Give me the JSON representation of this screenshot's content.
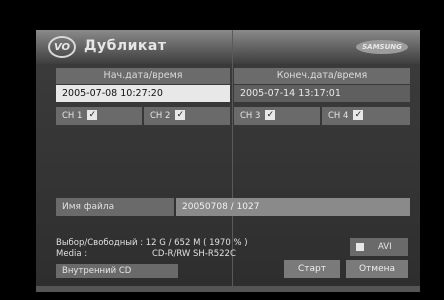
{
  "title": "Дубликат",
  "logo_text": "VO",
  "brand": "SAMSUNG",
  "start_header": "Нач.дата/время",
  "end_header": "Конеч.дата/время",
  "start_value": "2005-07-08   10:27:20",
  "end_value": "2005-07-14   13:17:01",
  "channels": [
    {
      "label": "CH 1",
      "checked": true
    },
    {
      "label": "CH 2",
      "checked": true
    },
    {
      "label": "CH 3",
      "checked": true
    },
    {
      "label": "CH 4",
      "checked": true
    }
  ],
  "file_label": "Имя файла",
  "file_value": "20050708 / 1027",
  "info_line1": "Выбор/Свободный : 12 G / 652 M ( 1970 % )",
  "info_line2_label": "Media :",
  "info_line2_value": "CD-R/RW SH-R522C",
  "cd_button": "Внутренний CD",
  "avi_label": "AVI",
  "start_button": "Старт",
  "cancel_button": "Отмена"
}
